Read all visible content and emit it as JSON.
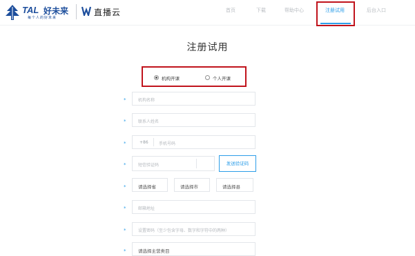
{
  "header": {
    "logo": {
      "tal": "TAL",
      "cn": "好未来",
      "slogan": "每个人的好未来"
    },
    "brand": "直播云",
    "nav": [
      {
        "label": "首页"
      },
      {
        "label": "下载"
      },
      {
        "label": "帮助中心"
      },
      {
        "label": "注册试用"
      },
      {
        "label": "后台入口"
      }
    ],
    "active_index": 3
  },
  "form": {
    "title": "注册试用",
    "options": [
      {
        "label": "机构开课",
        "selected": true
      },
      {
        "label": "个人开课",
        "selected": false
      }
    ],
    "required_mark": "*",
    "org_name_placeholder": "机构名称",
    "contact_placeholder": "联系人姓名",
    "phone_prefix": "+86",
    "phone_placeholder": "手机号码",
    "code_placeholder": "短信验证码",
    "send_code": "发送验证码",
    "province": "请选择省",
    "city": "请选择市",
    "county": "请选择县",
    "email_placeholder": "邮箱地址",
    "password_placeholder": "设置密码（至少包含字母、数字和字符中的两种）",
    "category": "请选择主营类目"
  },
  "colors": {
    "accent": "#2b9de8",
    "annotation": "#c0121b",
    "brand": "#1d4e9c"
  }
}
